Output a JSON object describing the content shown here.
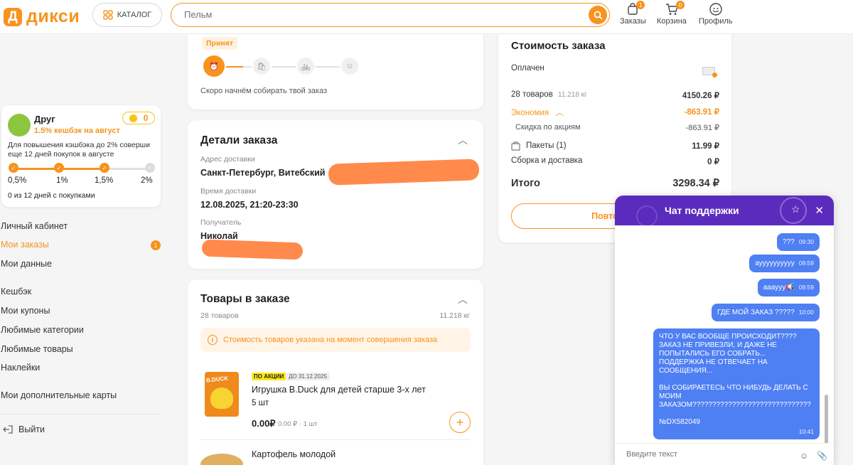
{
  "header": {
    "logo_badge": "Д",
    "logo_text": "дикси",
    "catalog_label": "КАТАЛОГ",
    "search_placeholder": "Пельм",
    "nav": [
      {
        "label": "Заказы",
        "badge": "1",
        "icon": "bag-icon"
      },
      {
        "label": "Корзина",
        "badge": "0",
        "icon": "cart-icon"
      },
      {
        "label": "Профиль",
        "icon": "profile-icon"
      }
    ]
  },
  "loyalty": {
    "name": "Друг",
    "cashback": "1.5% кешбэк на август",
    "coins": "0",
    "description": "Для повышения кэшбэка до 2% соверши еще 12 дней покупок в августе",
    "levels": [
      "0,5%",
      "1%",
      "1,5%",
      "2%"
    ],
    "days": "0 из 12 дней с покупками"
  },
  "side_menu": {
    "items": [
      "Личный кабинет",
      "Мои заказы",
      "Мои данные",
      "Кешбэк",
      "Мои купоны",
      "Любимые категории",
      "Любимые товары",
      "Наклейки",
      "Мои дополнительные карты",
      "Выйти"
    ],
    "orders_badge": "1"
  },
  "status_card": {
    "tag": "Принят",
    "text": "Скоро начнём собирать твой заказ"
  },
  "details": {
    "title": "Детали заказа",
    "address_label": "Адрес доставки",
    "address_value": "Санкт-Петербург, Витебский",
    "time_label": "Время доставки",
    "time_value": "12.08.2025, 21:20-23:30",
    "recipient_label": "Получатель",
    "recipient_value": "Николай"
  },
  "goods": {
    "title": "Товары в заказе",
    "count": "28 товаров",
    "weight": "11.218 кг",
    "info": "Стоимость товаров указана на момент совершения заказа",
    "products": [
      {
        "promo": "ПО АКЦИИ",
        "until": "ДО 31.12.2025",
        "name": "Игрушка B.Duck для детей старше 3-х лет",
        "qty": "5 шт",
        "price": "0.00₽",
        "sub": "0.00 ₽ · 1 шт",
        "img_text": "B.DUCK"
      },
      {
        "name": "Картофель молодой"
      }
    ]
  },
  "summary": {
    "title": "Стоимость заказа",
    "paid": "Оплачен",
    "items_label": "28 товаров",
    "items_weight": "11.218 кг",
    "items_value": "4150.26 ₽",
    "savings_label": "Экономия",
    "savings_value": "-863.91 ₽",
    "discount_label": "Скидка по акциям",
    "discount_value": "-863.91 ₽",
    "bags_label": "Пакеты (1)",
    "bags_value": "11.99 ₽",
    "delivery_label": "Сборка и доставка",
    "delivery_value": "0 ₽",
    "total_label": "Итого",
    "total_value": "3298.34 ₽",
    "repeat_label": "Повторить"
  },
  "chat": {
    "title": "Чат поддержки",
    "input_placeholder": "Введите текст",
    "messages": [
      {
        "text": "???",
        "time": "09:30"
      },
      {
        "text": "ауууууууууу",
        "time": "09:59"
      },
      {
        "text": "аааууу📢",
        "time": "09:59"
      },
      {
        "text": "ГДЕ МОЙ ЗАКАЗ ?????",
        "time": "10:00"
      },
      {
        "text": "ЧТО У ВАС ВООБЩЕ ПРОИСХОДИТ????\nЗАКАЗ НЕ ПРИВЕЗЛИ, И ДАЖЕ НЕ\nПОПЫТАЛИСЬ ЕГО СОБРАТЬ...\nПОДДЕРЖКА НЕ ОТВЕЧАЕТ НА\nСООБЩЕНИЯ...\n\nВЫ СОБИРАЕТЕСЬ ЧТО НИБУДЬ ДЕЛАТЬ С\nМОИМ\nЗАКАЗОМ??????????????????????????????\n\n№DX582049",
        "time": "10:41"
      }
    ]
  },
  "colors": {
    "brand": "#f7931e",
    "chat_header": "#5b2bbd",
    "bubble": "#4e7ff3"
  }
}
